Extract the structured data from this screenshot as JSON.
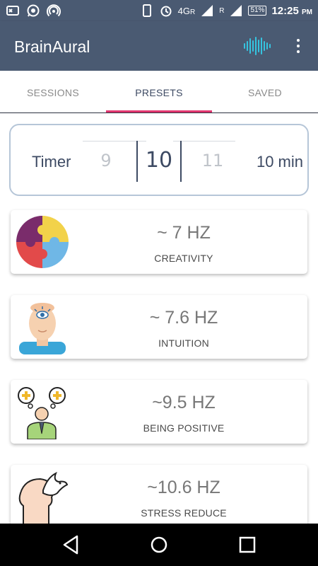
{
  "status_bar": {
    "time": "12:25",
    "ampm": "PM",
    "network": "4G",
    "network_sub": "R",
    "signal_sub": "R",
    "battery": "51%"
  },
  "app_bar": {
    "title": "BrainAural",
    "icons": [
      "audio-wave-icon",
      "more-vert-icon"
    ]
  },
  "tabs": [
    {
      "label": "SESSIONS",
      "active": false
    },
    {
      "label": "PRESETS",
      "active": true
    },
    {
      "label": "SAVED",
      "active": false
    }
  ],
  "timer": {
    "label": "Timer",
    "picker": {
      "prev": "9",
      "selected": "10",
      "next": "11"
    },
    "duration": "10 min"
  },
  "presets": [
    {
      "frequency": "~ 7 HZ",
      "name": "CREATIVITY",
      "icon": "puzzle-head-icon"
    },
    {
      "frequency": "~ 7.6 HZ",
      "name": "INTUITION",
      "icon": "third-eye-icon"
    },
    {
      "frequency": "~9.5 HZ",
      "name": "BEING POSITIVE",
      "icon": "positive-thoughts-icon"
    },
    {
      "frequency": "~10.6 HZ",
      "name": "STRESS REDUCE",
      "icon": "dove-head-icon"
    }
  ],
  "colors": {
    "primary": "#4a5a72",
    "accent": "#e0356e",
    "text_dark": "#3d4a63"
  }
}
